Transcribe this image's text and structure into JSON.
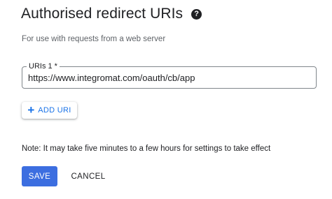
{
  "section": {
    "title": "Authorised redirect URIs",
    "help_icon": "question-icon",
    "subtitle": "For use with requests from a web server"
  },
  "uri_field": {
    "label": "URIs 1 *",
    "value": "https://www.integromat.com/oauth/cb/app"
  },
  "add_uri_button": {
    "icon": "+",
    "label": "ADD URI"
  },
  "note": "Note: It may take five minutes to a few hours for settings to take effect",
  "actions": {
    "save_label": "SAVE",
    "cancel_label": "CANCEL"
  },
  "colors": {
    "primary": "#3c6ee0",
    "link": "#1a73e8",
    "text": "#202124",
    "muted": "#5f6368"
  }
}
